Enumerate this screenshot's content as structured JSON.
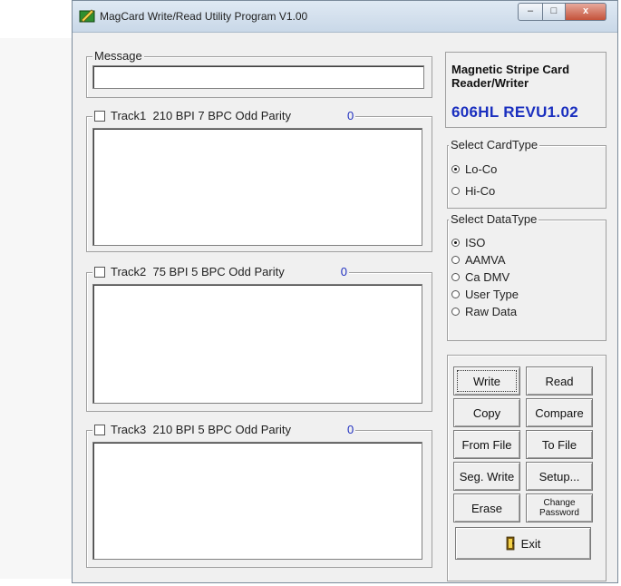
{
  "window": {
    "title": "MagCard Write/Read Utility Program V1.00",
    "controls": {
      "minimize": "–",
      "maximize": "□",
      "close": "x"
    }
  },
  "message": {
    "label": "Message",
    "value": ""
  },
  "brand": {
    "line1": "Magnetic Stripe Card",
    "line1b": "Reader/Writer",
    "model": "606HL REVU1.02"
  },
  "tracks": [
    {
      "label": "Track1",
      "spec": "210 BPI 7 BPC Odd Parity",
      "count": "0",
      "checked": false
    },
    {
      "label": "Track2",
      "spec": "75 BPI 5 BPC Odd Parity",
      "count": "0",
      "checked": false
    },
    {
      "label": "Track3",
      "spec": "210 BPI 5 BPC Odd Parity",
      "count": "0",
      "checked": false
    }
  ],
  "card_type": {
    "label": "Select CardType",
    "options": [
      {
        "label": "Lo-Co",
        "selected": true
      },
      {
        "label": "Hi-Co",
        "selected": false
      }
    ]
  },
  "data_type": {
    "label": "Select DataType",
    "options": [
      {
        "label": "ISO",
        "selected": true
      },
      {
        "label": "AAMVA",
        "selected": false
      },
      {
        "label": "Ca DMV",
        "selected": false
      },
      {
        "label": "User Type",
        "selected": false
      },
      {
        "label": "Raw Data",
        "selected": false
      }
    ]
  },
  "buttons": {
    "write": "Write",
    "read": "Read",
    "copy": "Copy",
    "compare": "Compare",
    "from_file": "From File",
    "to_file": "To File",
    "seg_write": "Seg. Write",
    "setup": "Setup...",
    "erase": "Erase",
    "change_password_1": "Change",
    "change_password_2": "Password",
    "exit": "Exit"
  },
  "colors": {
    "accent": "#1a2fbf",
    "count": "#2030c0"
  }
}
